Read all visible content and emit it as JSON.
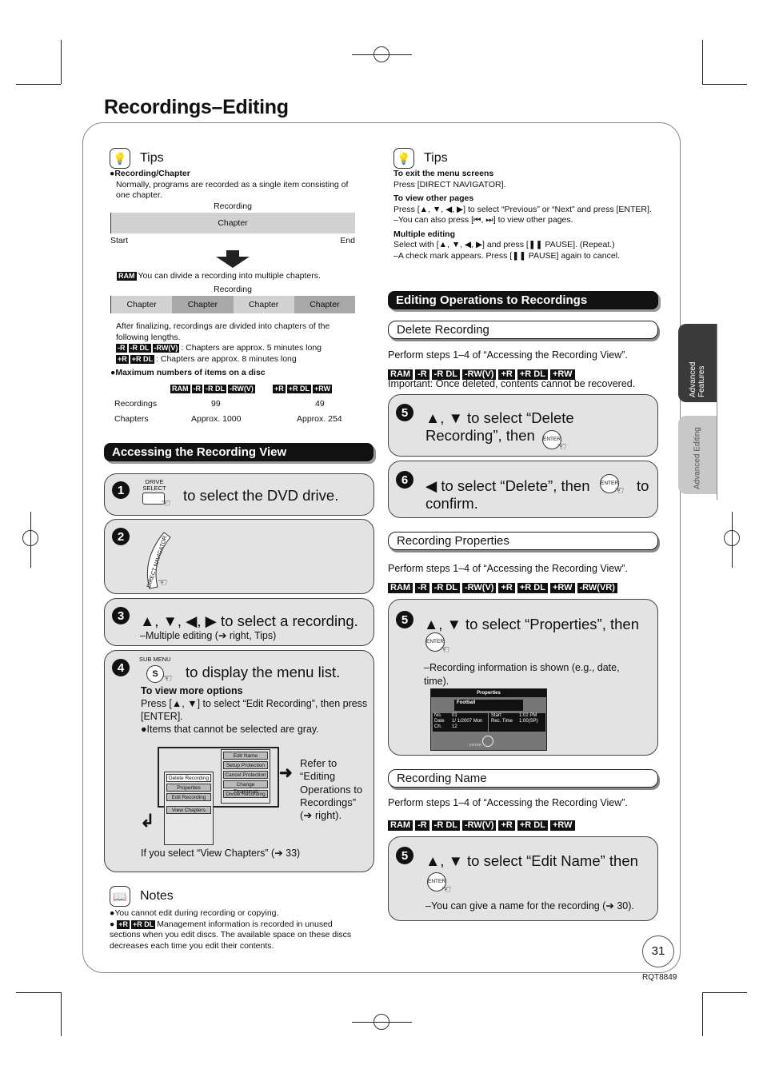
{
  "page": {
    "title": "Recordings–Editing",
    "page_number": "31",
    "doc_code": "RQT8849"
  },
  "side_tabs": [
    "Advanced Features",
    "Advanced Editing"
  ],
  "tips_left": {
    "heading": "Tips",
    "recording_chapter_title": "●Recording/Chapter",
    "recording_chapter_text": "Normally, programs are recorded as a single item consisting of one chapter.",
    "diagram1": {
      "recording_label": "Recording",
      "chapter_label": "Chapter",
      "start": "Start",
      "end": "End"
    },
    "ram_note": "You can divide a recording into multiple chapters.",
    "diagram2": {
      "recording_label": "Recording",
      "chapters": [
        "Chapter",
        "Chapter",
        "Chapter",
        "Chapter"
      ]
    },
    "finalize_text": "After finalizing, recordings are divided into chapters of the following lengths.",
    "line1_badges": [
      "-R",
      "-R DL",
      "-RW(V)"
    ],
    "line1_text": ": Chapters are approx. 5 minutes long",
    "line2_badges": [
      "+R",
      "+R DL"
    ],
    "line2_text": ": Chapters are approx. 8 minutes long",
    "max_title": "●Maximum numbers of items on a disc",
    "table": {
      "group1_badges": [
        "RAM",
        "-R",
        "-R DL",
        "-RW(V)"
      ],
      "group2_badges": [
        "+R",
        "+R DL",
        "+RW"
      ],
      "rows": [
        {
          "label": "Recordings",
          "group1": "99",
          "group2": "49"
        },
        {
          "label": "Chapters",
          "group1": "Approx. 1000",
          "group2": "Approx. 254"
        }
      ]
    }
  },
  "accessing": {
    "heading": "Accessing the Recording View",
    "step1": {
      "num": "1",
      "button_label": "DRIVE SELECT",
      "text": "to select the DVD drive."
    },
    "step2": {
      "num": "2",
      "button_label": "DIRECT NAVIGATOR"
    },
    "step3": {
      "num": "3",
      "text": "▲, ▼, ◀, ▶ to select a recording.",
      "sub": "–Multiple editing (➔ right, Tips)"
    },
    "step4": {
      "num": "4",
      "button_label": "SUB MENU",
      "button_glyph": "S",
      "text": "to display the menu list.",
      "more_title": "To view more options",
      "more_text": "Press [▲, ▼] to select “Edit Recording”, then press [ENTER].",
      "gray_note": "●Items that cannot be selected are gray.",
      "menu_main": [
        "Delete Recording",
        "Properties",
        "Edit Recording",
        "View Chapters"
      ],
      "menu_sub": [
        "Edit Name",
        "Setup Protection",
        "Cancel Protection",
        "Change Thumbnail",
        "Divide Recording"
      ],
      "refer_text": "Refer to “Editing Operations to Recordings” (➔ right).",
      "view_chapters_note": "If you select “View Chapters” (➔ 33)"
    }
  },
  "notes": {
    "heading": "Notes",
    "item1": "●You cannot edit during recording or copying.",
    "item2_badges": [
      "+R",
      "+R DL"
    ],
    "item2": "Management information is recorded in unused sections when you edit discs. The available space on these discs decreases each time you edit their contents."
  },
  "tips_right": {
    "heading": "Tips",
    "exit_title": "To exit the menu screens",
    "exit_text": "Press [DIRECT NAVIGATOR].",
    "pages_title": "To view other pages",
    "pages_text": "Press [▲, ▼, ◀, ▶] to select “Previous” or “Next” and press [ENTER].",
    "pages_text2": "–You can also press [⏮, ⏭] to view other pages.",
    "multi_title": "Multiple editing",
    "multi_text": "Select with [▲, ▼, ◀, ▶] and press [❚❚ PAUSE]. (Repeat.)",
    "multi_text2": "–A check mark appears. Press [❚❚ PAUSE] again to cancel."
  },
  "editing_ops": {
    "heading": "Editing Operations to Recordings",
    "delete": {
      "heading": "Delete Recording",
      "perform": "Perform steps 1–4 of “Accessing the Recording View”.",
      "badges": [
        "RAM",
        "-R",
        "-R DL",
        "-RW(V)",
        "+R",
        "+R DL",
        "+RW"
      ],
      "important": "Important: Once deleted, contents cannot be recovered.",
      "step5": {
        "num": "5",
        "text": "▲, ▼ to select “Delete Recording”, then"
      },
      "step6": {
        "num": "6",
        "text_a": "◀ to select “Delete”, then",
        "text_b": "to confirm."
      }
    },
    "properties": {
      "heading": "Recording Properties",
      "perform": "Perform steps 1–4 of “Accessing the Recording View”.",
      "badges": [
        "RAM",
        "-R",
        "-R DL",
        "-RW(V)",
        "+R",
        "+R DL",
        "+RW",
        "-RW(VR)"
      ],
      "step5": {
        "num": "5",
        "text": "▲, ▼ to select “Properties”, then",
        "sub": "–Recording information is shown (e.g., date, time)."
      },
      "screen": {
        "title": "Properties",
        "name": "Football",
        "left_labels": [
          "No.",
          "Date",
          "Ch."
        ],
        "left_values": [
          "01",
          "1/ 1/2007 Mon",
          "12"
        ],
        "right_labels": [
          "Start",
          "Rec. Time"
        ],
        "right_values": [
          "1:02 PM",
          "1:00(SP)"
        ],
        "enter_label": "ENTER"
      }
    },
    "name": {
      "heading": "Recording Name",
      "perform": "Perform steps 1–4 of “Accessing the Recording View”.",
      "badges": [
        "RAM",
        "-R",
        "-R DL",
        "-RW(V)",
        "+R",
        "+R DL",
        "+RW"
      ],
      "step5": {
        "num": "5",
        "text": "▲, ▼ to select “Edit Name” then",
        "sub": "–You can give a name for the recording (➔ 30)."
      }
    }
  },
  "enter_label": "ENTER"
}
